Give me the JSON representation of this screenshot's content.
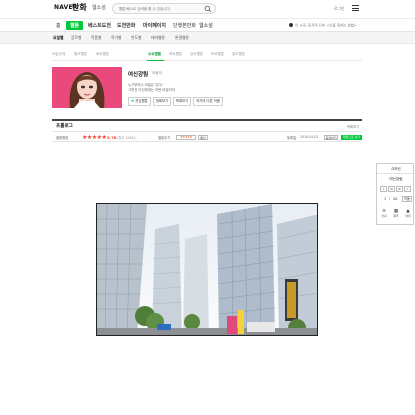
{
  "header": {
    "brand": "NAVER",
    "service": "만화",
    "sub_service": "웹소설",
    "search_placeholder": "웹툰/베스트 검색을 할 수 있습니다.",
    "login": "로그인"
  },
  "mainnav": {
    "items": [
      "홈",
      "웹툰",
      "베스트도전",
      "도전만화",
      "마이페이지",
      "단행본만화",
      "웹소설"
    ],
    "active_index": 1,
    "notice": "이 시국, 마지막 단추 <신중 축하는 방법>"
  },
  "subnav": {
    "items": [
      "요일별",
      "장르별",
      "작품별",
      "작가별",
      "연도별",
      "테마웹툰",
      "완결웹툰"
    ],
    "active_index": 0
  },
  "daytabs": {
    "items": [
      "요일전체",
      "월요웹툰",
      "화요웹툰",
      "수요웹툰",
      "목요웹툰",
      "금요웹툰",
      "토요웹툰",
      "일요웹툰"
    ],
    "active_index": 3
  },
  "comic": {
    "title": "여신강림",
    "author": "야옹이",
    "desc_line1": "누구부러나 비밀은 있다!",
    "desc_line2": "그런건 이신에게는 어떤 비밀이야",
    "buttons": [
      "관심웹툰",
      "첫회보기",
      "목록보기",
      "작가의 다른 작품"
    ]
  },
  "episode": {
    "title": "프롤로그",
    "list_label": "목록보기",
    "rating_label": "별점평점",
    "score": "9.78",
    "count": "(참여 10981)",
    "my_rating_label": "별점주기",
    "rate_button": "확인",
    "date_label": "등록일",
    "date": "2018.04.02",
    "share": "공유하기",
    "cut_button": "컷툰으로 보기"
  },
  "remote": {
    "title": "리모컨",
    "name": "여신강림",
    "page_current": "1",
    "page_sep": "/",
    "page_total": "20",
    "go": "이동",
    "icons": [
      {
        "icon": "list-icon",
        "label": "첫회"
      },
      {
        "icon": "grid-icon",
        "label": "목록"
      },
      {
        "icon": "top-icon",
        "label": "맨위"
      }
    ]
  },
  "colors": {
    "brand_green": "#00c73c",
    "rating_red": "#f6392b",
    "thumb_pink": "#e94a7b"
  }
}
